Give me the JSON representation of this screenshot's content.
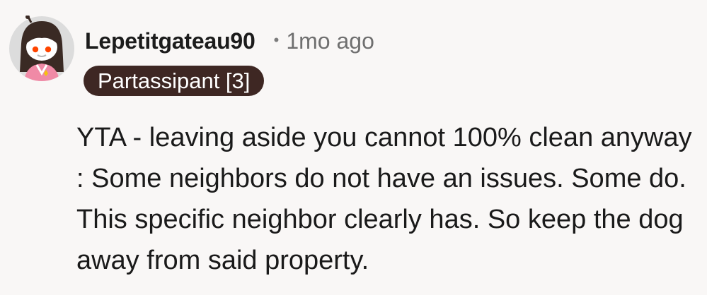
{
  "comment": {
    "author": "Lepetitgateau90",
    "separator": "•",
    "timestamp": "1mo ago",
    "flair": "Partassipant [3]",
    "body": "YTA - leaving aside you cannot 100% clean anyway : Some neighbors do not have an issues. Some do. This specific neighbor clearly has. So keep the dog away from said property.",
    "avatar_icon": "reddit-snoo-avatar"
  },
  "colors": {
    "background": "#f9f7f6",
    "flair_background": "#3e2723",
    "flair_text": "#ffffff",
    "meta_text": "#6f6f6f"
  }
}
